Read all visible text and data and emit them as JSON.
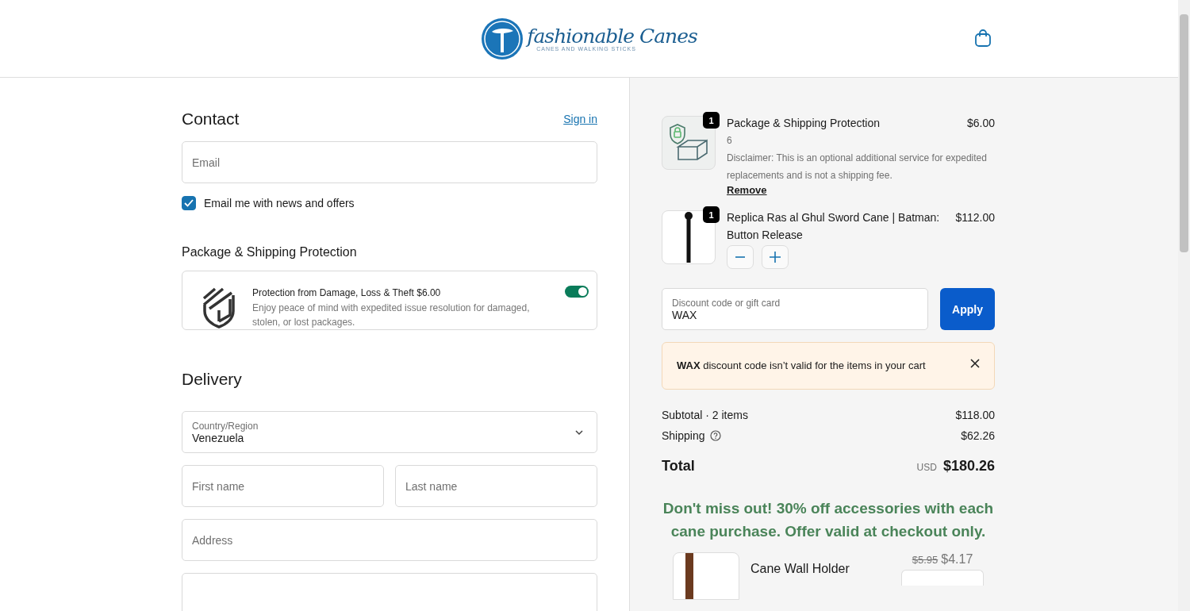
{
  "header": {
    "logo_title": "fashionable Canes",
    "logo_tagline": "CANES AND WALKING STICKS"
  },
  "contact": {
    "title": "Contact",
    "sign_in": "Sign in",
    "email_placeholder": "Email",
    "news_checkbox": {
      "label": "Email me with news and offers",
      "checked": true
    }
  },
  "protection": {
    "title": "Package & Shipping Protection",
    "headline": "Protection from Damage, Loss & Theft $6.00",
    "description": "Enjoy peace of mind with expedited issue resolution for damaged, stolen, or lost packages.",
    "on": true
  },
  "delivery": {
    "title": "Delivery",
    "country_label": "Country/Region",
    "country_value": "Venezuela",
    "first_name_placeholder": "First name",
    "last_name_placeholder": "Last name",
    "address_placeholder": "Address"
  },
  "cart": {
    "items": [
      {
        "kind": "protection",
        "quantity": "1",
        "name": "Package & Shipping Protection",
        "price": "$6.00",
        "variant": "6",
        "note": "Disclaimer: This is an optional additional service for expedited replacements and is not a shipping fee.",
        "remove": "Remove"
      },
      {
        "kind": "product",
        "quantity": "1",
        "name": "Replica Ras al Ghul Sword Cane | Batman: Button Release",
        "price": "$112.00"
      }
    ]
  },
  "discount": {
    "label": "Discount code or gift card",
    "value": "WAX",
    "apply": "Apply",
    "error": "**WAX** discount code isn’t valid for the items in your cart"
  },
  "summary": {
    "subtotal_label": "Subtotal · 2 items",
    "subtotal": "$118.00",
    "shipping_label": "Shipping",
    "shipping": "$62.26",
    "total_label": "Total",
    "currency": "USD",
    "total": "$180.26"
  },
  "promo": {
    "text": "Don't miss out! 30% off accessories with each cane purchase. Offer valid at checkout only.",
    "items": [
      {
        "name": "Cane Wall Holder",
        "old_price": "$5.95",
        "price": "$4.17"
      }
    ]
  }
}
